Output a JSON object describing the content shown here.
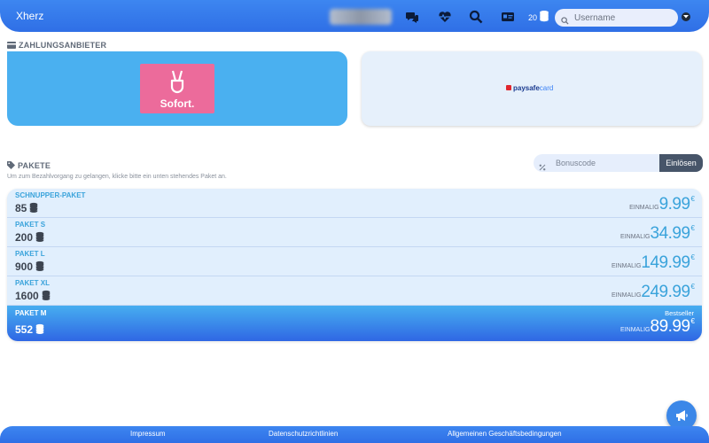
{
  "header": {
    "brand": "Xherz",
    "blurred_chip_label": "",
    "coins": "20",
    "username_placeholder": "Username",
    "icons": [
      "chat-icon",
      "heart-pulse-icon",
      "search-icon",
      "id-card-icon",
      "coins-icon",
      "search-icon",
      "chevron-down-icon"
    ]
  },
  "payment": {
    "title": "ZAHLUNGSANBIETER",
    "providers": [
      {
        "name": "Sofort.",
        "color": "#ec6b9b"
      },
      {
        "name_part1": "paysafe",
        "name_part2": "card"
      }
    ]
  },
  "packages": {
    "title": "PAKETE",
    "subtitle": "Um zum Bezahlvorgang zu gelangen, klicke bitte ein unten stehendes Paket an.",
    "bonus_placeholder": "Bonuscode",
    "bonus_button": "Einlösen",
    "once_label": "EINMALIG",
    "currency": "€",
    "items": [
      {
        "name": "SCHNUPPER-PAKET",
        "coins": "85",
        "price": "9.99"
      },
      {
        "name": "PAKET S",
        "coins": "200",
        "price": "34.99"
      },
      {
        "name": "PAKET L",
        "coins": "900",
        "price": "149.99"
      },
      {
        "name": "PAKET XL",
        "coins": "1600",
        "price": "249.99"
      },
      {
        "name": "PAKET M",
        "coins": "552",
        "price": "89.99",
        "badge": "Bestseller"
      }
    ]
  },
  "footer": {
    "links": [
      "Impressum",
      "Datenschutzrichtlinien",
      "Allgemeinen Geschäftsbedingungen"
    ]
  },
  "colors": {
    "accent": "#2f6fe6",
    "price_blue": "#3aa3db",
    "bonus_button": "#475569"
  }
}
